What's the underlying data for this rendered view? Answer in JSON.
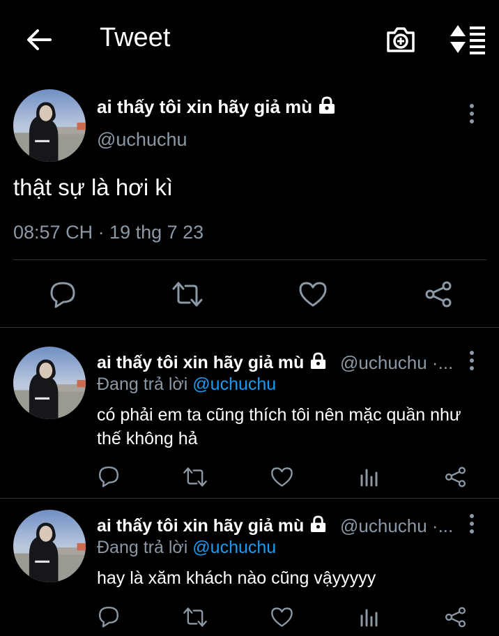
{
  "header": {
    "title": "Tweet",
    "back_icon": "arrow-left-icon",
    "camera_icon": "camera-plus-icon",
    "sort_icon": "sort-icon"
  },
  "main_tweet": {
    "author_name": "ai thấy tôi xin hãy giả mù",
    "handle": "@uchuchu",
    "text": "thật sự là hơi kì",
    "timestamp": "08:57 CH · 19 thg 7 23"
  },
  "replies": [
    {
      "author_name": "ai thấy tôi xin hãy giả mù",
      "handle": "@uchuchu ·...",
      "replying_label": "Đang trả lời",
      "replying_to": "@uchuchu",
      "text": "có phải em ta cũng thích tôi nên mặc quần như thế không hả"
    },
    {
      "author_name": "ai thấy tôi xin hãy giả mù",
      "handle": "@uchuchu ·...",
      "replying_label": "Đang trả lời",
      "replying_to": "@uchuchu",
      "text": "hay là xăm khách nào cũng vậyyyyy"
    }
  ],
  "colors": {
    "background": "#000000",
    "text": "#e7e9ea",
    "muted": "#8b98a5",
    "accent": "#1d9bf0",
    "divider": "#2f3336"
  }
}
